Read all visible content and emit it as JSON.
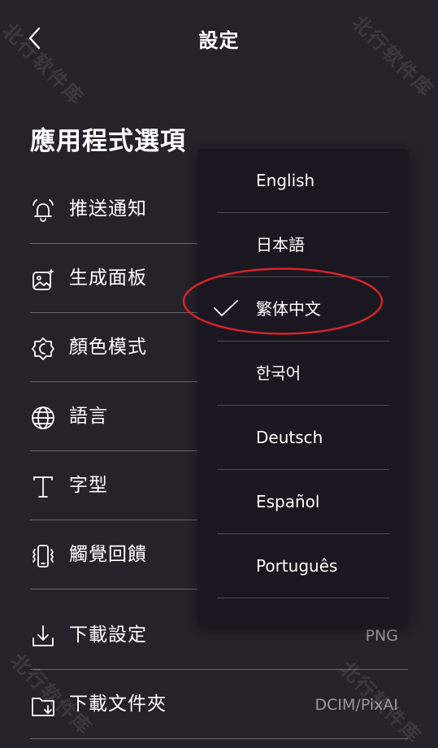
{
  "header": {
    "title": "設定"
  },
  "section": {
    "title": "應用程式選項"
  },
  "rows": [
    {
      "label": "推送通知"
    },
    {
      "label": "生成面板"
    },
    {
      "label": "顏色模式"
    },
    {
      "label": "語言"
    },
    {
      "label": "字型"
    },
    {
      "label": "觸覺回饋"
    },
    {
      "label": "下載設定",
      "value": "PNG"
    },
    {
      "label": "下載文件夾",
      "value": "DCIM/PixAI"
    }
  ],
  "language_menu": {
    "options": [
      "English",
      "日本語",
      "繁体中文",
      "한국어",
      "Deutsch",
      "Español",
      "Português"
    ],
    "selected": "繁体中文"
  },
  "annotation": {
    "color": "#d8222a"
  },
  "watermark": {
    "text": "北行软件库"
  }
}
